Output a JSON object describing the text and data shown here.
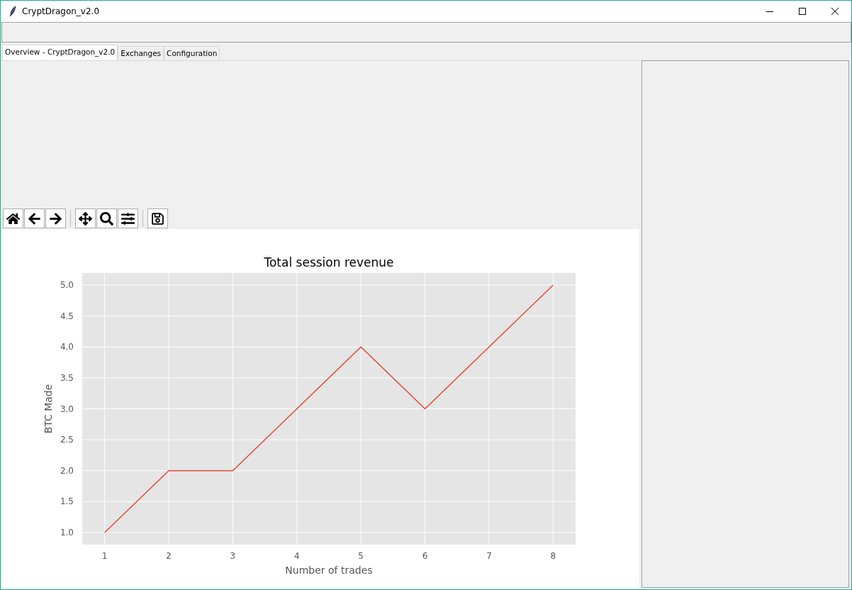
{
  "window": {
    "title": "CryptDragon_v2.0"
  },
  "tabs": [
    {
      "label": "Overview - CryptDragon_v2.0",
      "selected": true
    },
    {
      "label": "Exchanges",
      "selected": false
    },
    {
      "label": "Configuration",
      "selected": false
    }
  ],
  "chart": {
    "chart_data": {
      "type": "line",
      "title": "Total session revenue",
      "xlabel": "Number of trades",
      "ylabel": "BTC Made",
      "x": [
        1,
        2,
        3,
        4,
        5,
        6,
        7,
        8
      ],
      "grid": true,
      "series": [
        {
          "color": "#e24a33",
          "values": [
            1,
            2,
            2,
            3,
            4,
            3,
            4,
            5
          ]
        }
      ],
      "xlim": [
        0.65,
        8.35
      ],
      "ylim": [
        0.805,
        5.195
      ],
      "xticks": [
        1,
        2,
        3,
        4,
        5,
        6,
        7,
        8
      ],
      "yticks": [
        {
          "value": 1,
          "label": "1.0"
        },
        {
          "value": 1.5,
          "label": "1.5"
        },
        {
          "value": 2,
          "label": "2.0"
        },
        {
          "value": 2.5,
          "label": "2.5"
        },
        {
          "value": 3,
          "label": "3.0"
        },
        {
          "value": 3.5,
          "label": "3.5"
        },
        {
          "value": 4,
          "label": "4.0"
        },
        {
          "value": 4.5,
          "label": "4.5"
        },
        {
          "value": 5,
          "label": "5.0"
        }
      ]
    }
  }
}
